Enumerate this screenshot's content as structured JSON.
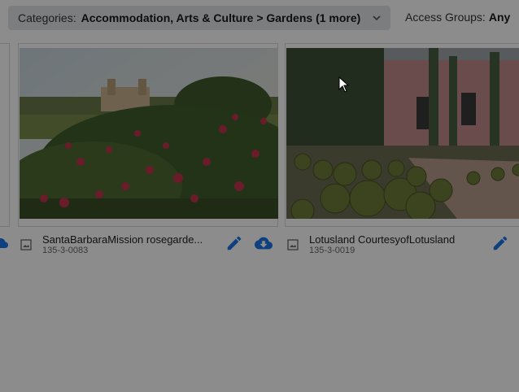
{
  "filters": {
    "categories_label": "Categories:",
    "categories_value": "Accommodation, Arts & Culture > Gardens (1 more)",
    "access_label": "Access Groups:",
    "access_value": "Any"
  },
  "cards": [
    {
      "title": "SantaBarbaraMission rosegarde...",
      "code": "135-3-0083",
      "image_icon": "image-icon",
      "edit_icon": "pencil-icon"
    },
    {
      "title": "Lotusland CourtesyofLotusland",
      "code": "135-3-0019",
      "image_icon": "image-icon",
      "download_icon": "cloud-download-icon",
      "edit_icon": "pencil-icon"
    }
  ],
  "colors": {
    "accent": "#1a73e8",
    "overlay": "rgba(0,0,0,0.45)",
    "filter_bg": "#e2e4e7"
  }
}
